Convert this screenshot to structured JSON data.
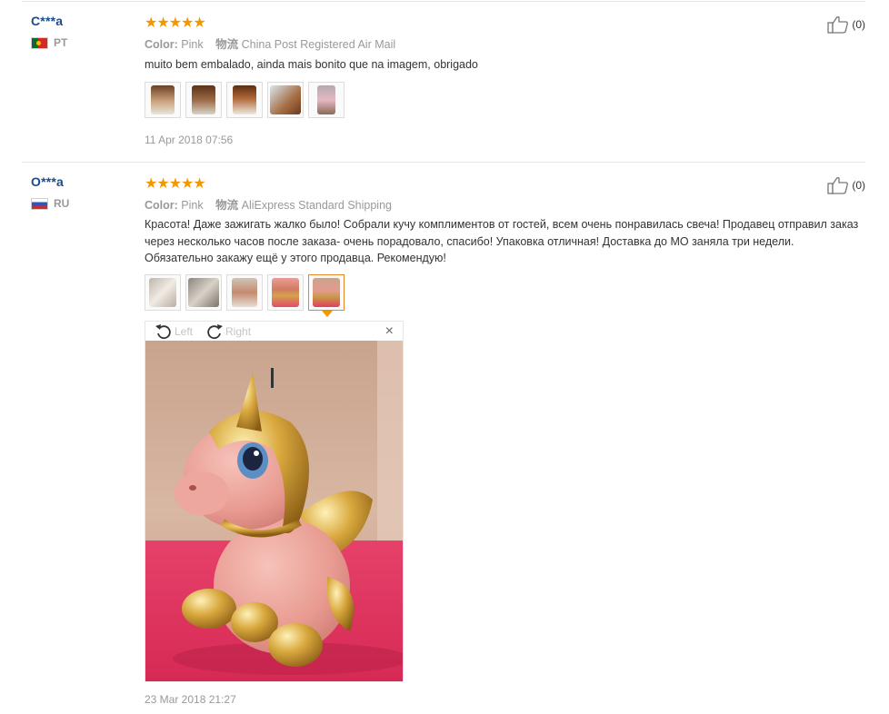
{
  "reviews": [
    {
      "user": "C***a",
      "country": "PT",
      "stars": "★★★★★",
      "color_label": "Color:",
      "color_value": "Pink",
      "ship_label": "物流",
      "ship_value": "China Post Registered Air Mail",
      "text": "muito bem embalado, ainda mais bonito que na imagem, obrigado",
      "date": "11 Apr 2018 07:56",
      "helpful": "(0)"
    },
    {
      "user": "O***a",
      "country": "RU",
      "stars": "★★★★★",
      "color_label": "Color:",
      "color_value": "Pink",
      "ship_label": "物流",
      "ship_value": "AliExpress Standard Shipping",
      "text": "Красота! Даже зажигать жалко было! Собрали кучу комплиментов от гостей, всем очень понравилась свеча! Продавец отправил заказ через несколько часов после заказа- очень порадовало, спасибо! Упаковка отличная! Доставка до МО заняла три недели. Обязательно закажу ещё у этого продавца. Рекомендую!",
      "date": "23 Mar 2018 21:27",
      "helpful": "(0)"
    }
  ],
  "viewer": {
    "rotate_left": "Left",
    "rotate_right": "Right",
    "close": "×"
  },
  "colors": {
    "star": "#f39800",
    "username": "#1a4b8c",
    "muted": "#999999",
    "active_thumb_border": "#e08a2c"
  },
  "icons": [
    "thumbs-up-icon",
    "rotate-left-icon",
    "rotate-right-icon",
    "close-icon",
    "portugal-flag-icon",
    "russia-flag-icon"
  ]
}
